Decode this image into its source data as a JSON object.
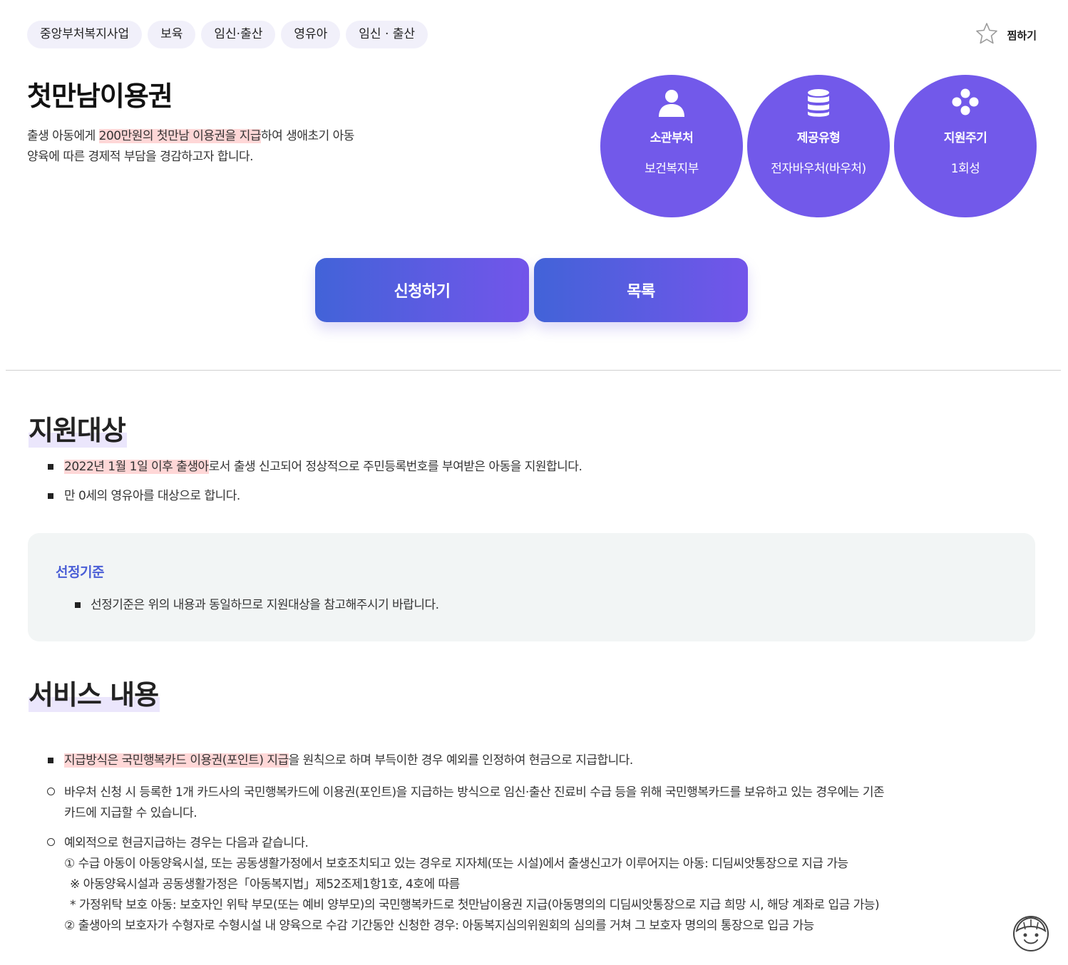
{
  "tags": [
    "중앙부처복지사업",
    "보육",
    "임신·출산",
    "영유아",
    "임신 · 출산"
  ],
  "favorite": {
    "label": "찜하기",
    "icon": "star-outline-icon"
  },
  "title": "첫만남이용권",
  "description": {
    "pre": "출생 아동에게 ",
    "highlight": "200만원의 첫만남 이용권을 지급",
    "post": "하여 생애초기 아동양육에 따른 경제적 부담을 경감하고자 합니다."
  },
  "info": [
    {
      "icon": "person-icon",
      "label": "소관부처",
      "value": "보건복지부"
    },
    {
      "icon": "database-icon",
      "label": "제공유형",
      "value": "전자바우처(바우처)"
    },
    {
      "icon": "dots-cluster-icon",
      "label": "지원주기",
      "value": "1회성"
    }
  ],
  "buttons": {
    "apply": "신청하기",
    "list": "목록"
  },
  "target": {
    "title": "지원대상",
    "item1_highlight": "2022년 1월 1일 이후 출생아",
    "item1_rest": "로서 출생 신고되어 정상적으로 주민등록번호를 부여받은 아동을 지원합니다.",
    "item2": "만 0세의 영유아를 대상으로 합니다."
  },
  "criteria": {
    "title": "선정기준",
    "item": "선정기준은 위의 내용과 동일하므로 지원대상을 참고해주시기 바랍니다."
  },
  "service": {
    "title": "서비스 내용",
    "item1_highlight": "지급방식은 국민행복카드 이용권(포인트) 지급",
    "item1_rest": "을 원칙으로 하며 부득이한 경우 예외를 인정하여 현금으로 지급합니다.",
    "item2_line1": "바우처 신청 시 등록한 1개 카드사의 국민행복카드에 이용권(포인트)을 지급하는 방식으로 임신·출산 진료비 수급 등을 위해 국민행복카드를 보유하고 있는 경우에는 기존",
    "item2_line2": "카드에 지급할 수 있습니다.",
    "item3": "예외적으로 현금지급하는 경우는 다음과 같습니다.",
    "sub1": "① 수급 아동이 아동양육시설, 또는 공동생활가정에서 보호조치되고 있는 경우로 지자체(또는 시설)에서 출생신고가 이루어지는 아동: 디딤씨앗통장으로 지급 가능",
    "sub2": "※ 아동양육시설과 공동생활가정은「아동복지법」제52조제1항1호, 4호에 따름",
    "sub3": "* 가정위탁 보호 아동: 보호자인 위탁 부모(또는 예비 양부모)의 국민행복카드로 첫만남이용권 지급(아동명의의 디딤씨앗통장으로 지급 희망 시, 해당 계좌로 입금 가능)",
    "sub4": "② 출생아의 보호자가 수형자로 수형시설 내 양육으로 수감 기간동안 신청한 경우: 아동복지심의위원회의 심의를 거쳐 그 보호자 명의의 통장으로 입금 가능"
  },
  "colors": {
    "accent": "#7259ea",
    "highlight": "#ffd7d7",
    "criteria_title": "#4a5ed6"
  }
}
